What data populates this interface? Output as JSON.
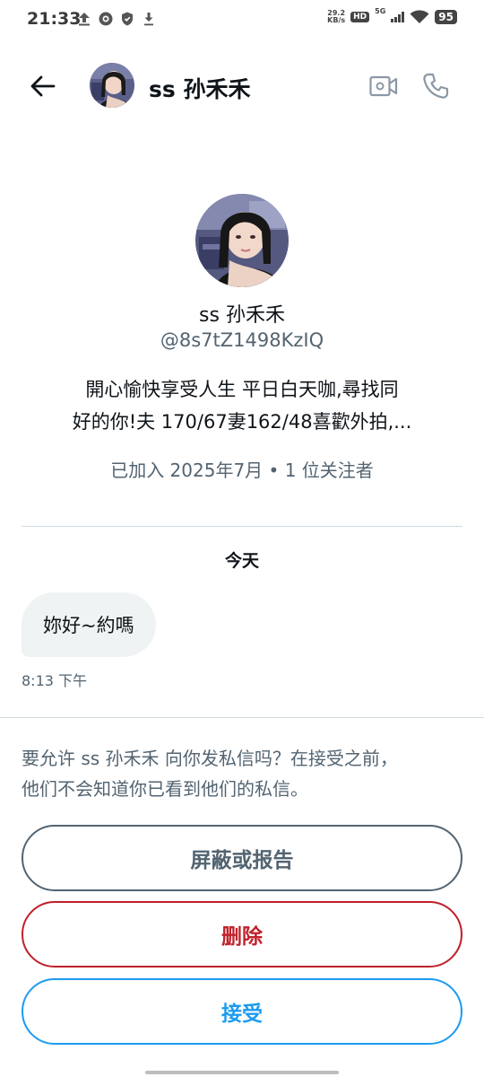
{
  "status_bar": {
    "time": "21:33",
    "speed_value": "29.2",
    "speed_unit": "KB/s",
    "hd": "HD",
    "network": "5G",
    "battery": "95"
  },
  "header": {
    "name": "ss 孙禾禾",
    "icons": [
      "back-arrow-icon",
      "video-icon",
      "phone-icon"
    ]
  },
  "profile": {
    "name": "ss 孙禾禾",
    "handle": "@8s7tZ1498KzIQ",
    "bio_line1": "開心愉快享受人生 平日白天咖,尋找同",
    "bio_line2": "好的你!夫 170/67妻162/48喜歡外拍,...",
    "meta": "已加入 2025年7月 • 1 位关注者"
  },
  "conversation": {
    "date_label": "今天",
    "message_text": "妳好~約嗎",
    "message_time": "8:13 下午"
  },
  "request": {
    "line1": "要允许 ss 孙禾禾 向你发私信吗？在接受之前，",
    "line2": "他们不会知道你已看到他们的私信。"
  },
  "buttons": {
    "block_report": "屏蔽或报告",
    "delete": "删除",
    "accept": "接受"
  },
  "colors": {
    "text_primary": "#0f1419",
    "text_secondary": "#536471",
    "delete_red": "#c0212b",
    "accept_blue": "#1d9bf0",
    "bubble_bg": "#eff3f4"
  }
}
